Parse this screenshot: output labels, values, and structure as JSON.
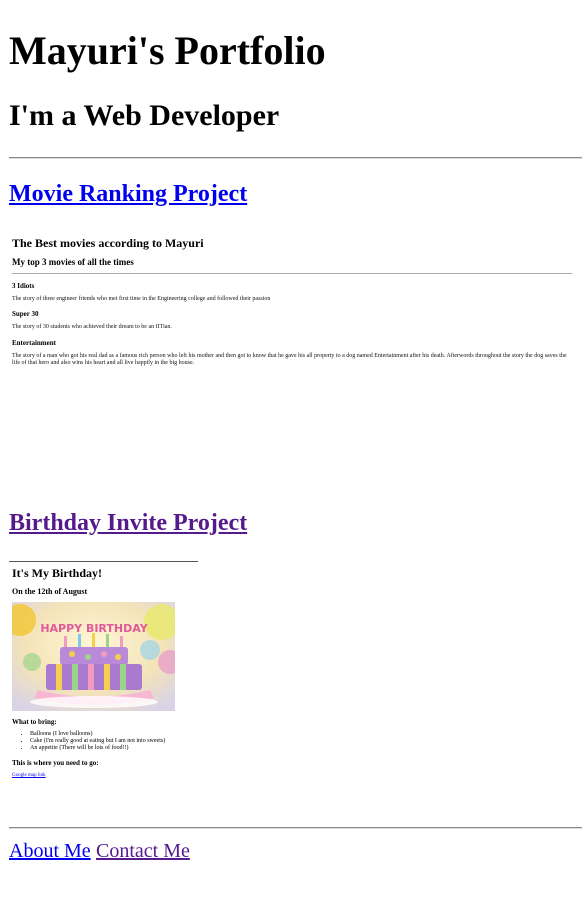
{
  "header": {
    "title": "Mayuri's Portfolio",
    "subtitle": "I'm a Web Developer"
  },
  "movie_project": {
    "link_label": "Movie Ranking Project",
    "heading": "The Best movies according to Mayuri",
    "subheading": "My top 3 movies of all the times",
    "movies": [
      {
        "title": "3 Idiots",
        "description": "The story of three engineer friends who met first time in the Engineering college and followed their passion"
      },
      {
        "title": "Super 30",
        "description": "The story of 30 students who achieved their dream to be an IITian."
      },
      {
        "title": "Entertainment",
        "description": "The story of a man who got his real dad as a famous rich person who left his mother and then got to know that he gave his all property to a dog named Entertainment after his death. Afterwords throughout the story the dog saves the life of that hero and also wins his heart and all live happily in the big house."
      }
    ]
  },
  "birthday_project": {
    "link_label": "Birthday Invite Project",
    "heading": "It's My Birthday!",
    "date_line": "On the 12th of August",
    "cake_banner": "HAPPY BIRTHDAY",
    "bring_heading": "What to bring:",
    "bring_items": [
      "Balloons (I love balloons)",
      "Cake (I'm really good at eating but I am not into sweets)",
      "An appetite (There will be lots of food!!)"
    ],
    "where_heading": "This is where you need to go:",
    "map_link": "Google map link"
  },
  "footer": {
    "about_label": "About Me",
    "contact_label": "Contact Me"
  },
  "colors": {
    "link": "#0000ee",
    "visited_link": "#551a8b",
    "rule": "#8a8a8a"
  }
}
